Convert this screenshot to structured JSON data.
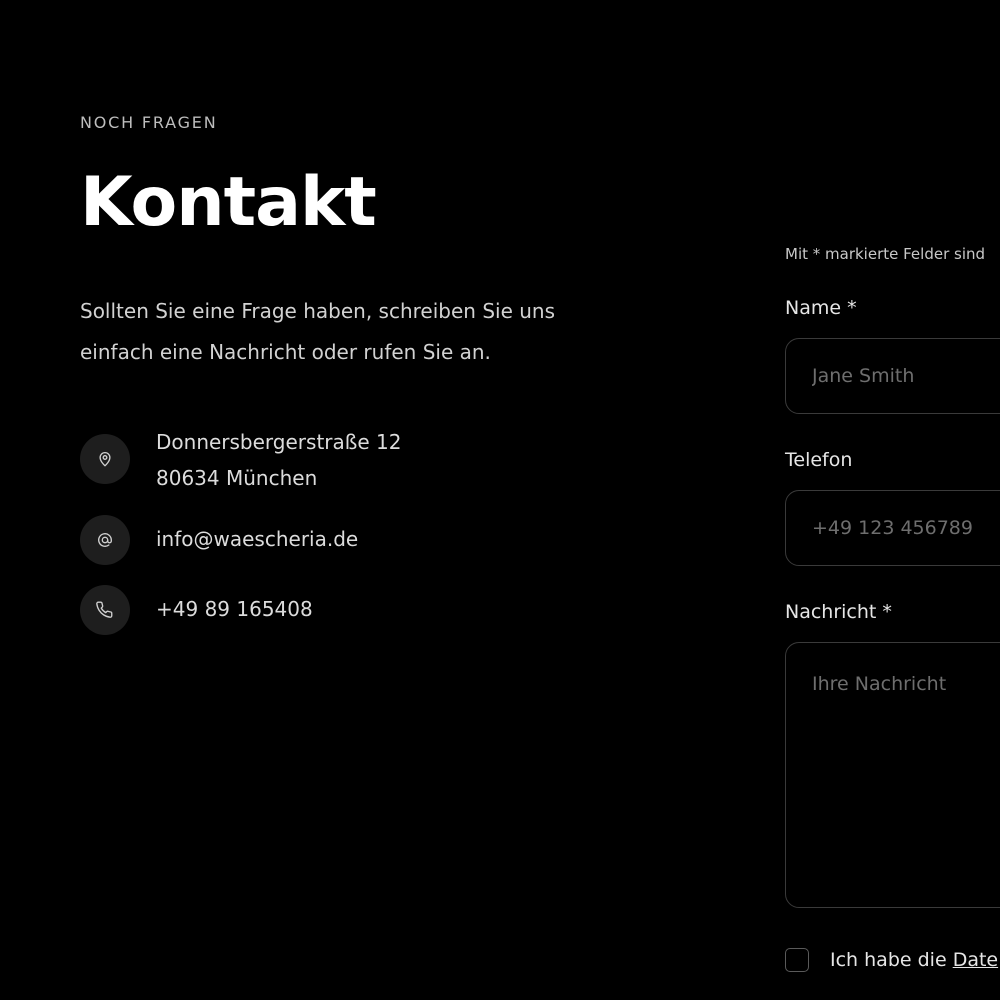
{
  "section": {
    "eyebrow": "NOCH FRAGEN",
    "title": "Kontakt",
    "intro": "Sollten Sie eine Frage haben, schreiben Sie uns einfach eine Nachricht oder rufen Sie an."
  },
  "contact": {
    "address_line1": "Donnersbergerstraße 12",
    "address_line2": "80634 München",
    "email": "info@waescheria.de",
    "phone": "+49 89 165408",
    "icons": [
      "location-pin-icon",
      "at-sign-icon",
      "phone-icon"
    ]
  },
  "form": {
    "required_note": "Mit * markierte Felder sind",
    "name_label": "Name *",
    "name_placeholder": "Jane Smith",
    "phone_label": "Telefon",
    "phone_placeholder": "+49 123 456789",
    "message_label": "Nachricht *",
    "message_placeholder": "Ihre Nachricht",
    "consent_prefix": "Ich habe die ",
    "consent_link": "Date"
  },
  "colors": {
    "background": "#000000",
    "text": "#e6e6e6",
    "muted": "#6e6e6e",
    "icon_circle": "#1e1e1e",
    "field_border": "#3a3a3a"
  }
}
